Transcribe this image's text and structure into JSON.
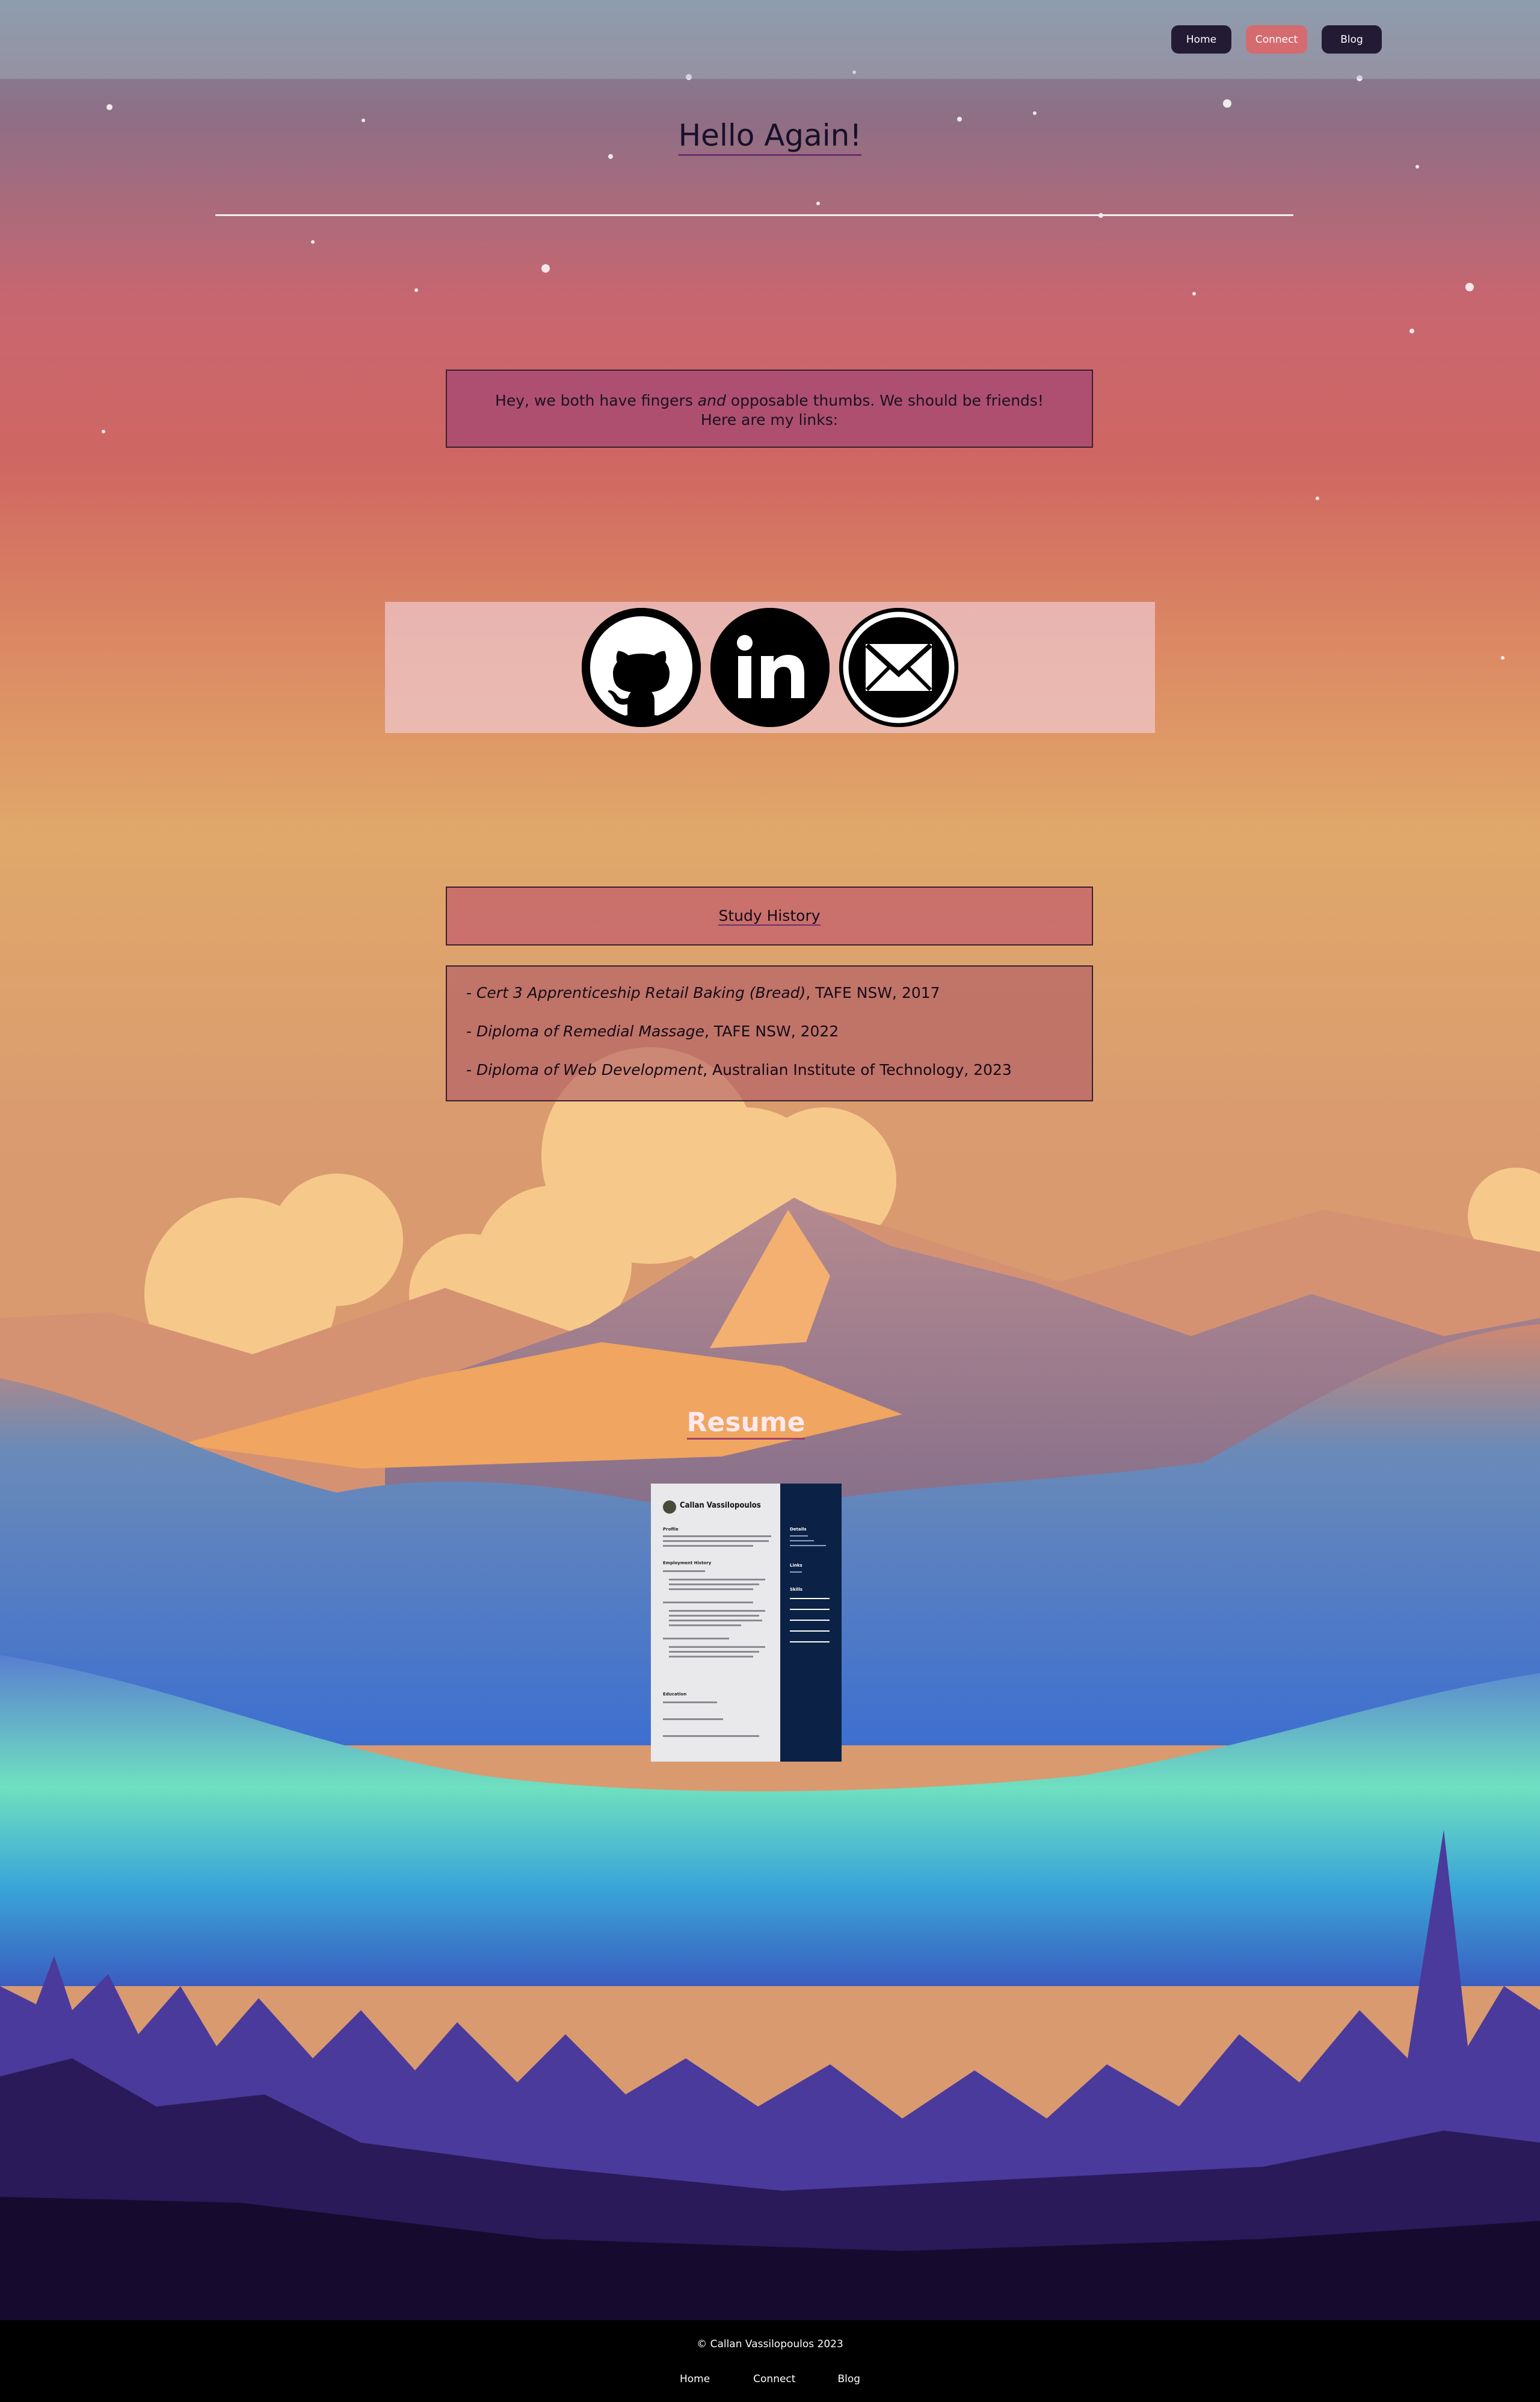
{
  "nav": {
    "home_label": "Home",
    "connect_label": "Connect",
    "blog_label": "Blog",
    "active": "Connect"
  },
  "page": {
    "title": "Hello Again!"
  },
  "intro": {
    "text_before": "Hey, we both have fingers ",
    "text_em": "and",
    "text_after": " opposable thumbs. We should be friends!",
    "line2": "Here are my links:"
  },
  "links": [
    {
      "icon": "github-icon",
      "name": "GitHub"
    },
    {
      "icon": "linkedin-icon",
      "name": "LinkedIn"
    },
    {
      "icon": "email-icon",
      "name": "Email"
    }
  ],
  "study": {
    "heading": "Study History",
    "items": [
      {
        "prefix": "- ",
        "course": "Cert 3 Apprenticeship Retail Baking (Bread)",
        "rest": ", TAFE NSW, 2017"
      },
      {
        "prefix": "- ",
        "course": "Diploma of Remedial Massage",
        "rest": ", TAFE NSW, 2022"
      },
      {
        "prefix": "- ",
        "course": "Diploma of Web Development",
        "rest": ", Australian Institute of Technology, 2023"
      }
    ]
  },
  "resume": {
    "heading": "Resume",
    "name": "Callan Vassilopoulos",
    "sections": [
      "Profile",
      "Employment History",
      "Education"
    ],
    "side_sections": [
      "Details",
      "Links",
      "Skills"
    ]
  },
  "footer": {
    "copyright": "© Callan Vassilopoulos 2023",
    "home_label": "Home",
    "connect_label": "Connect",
    "blog_label": "Blog"
  },
  "colors": {
    "nav_button": "#231b34",
    "nav_active": "#d56b6f",
    "footer_bg": "#000000"
  }
}
